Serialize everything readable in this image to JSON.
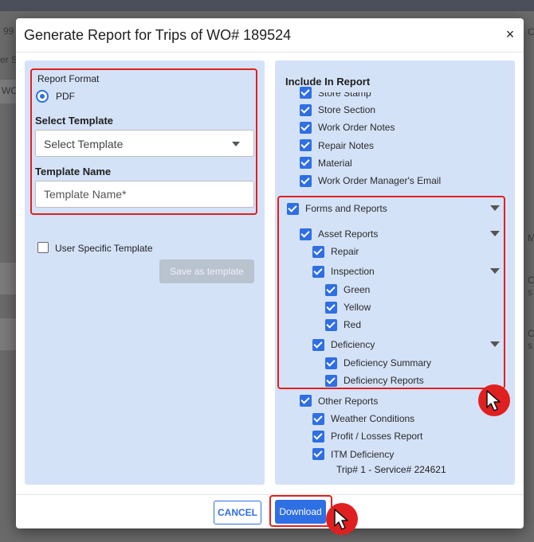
{
  "background": {
    "left_labels": [
      "99",
      "er S",
      "WC"
    ],
    "right_labels": [
      "C",
      "M",
      "C",
      "s",
      "C",
      "s"
    ]
  },
  "modal": {
    "title": "Generate Report for Trips of WO# 189524",
    "close_icon": "close-icon",
    "close_label": "×"
  },
  "left": {
    "report_format_label": "Report Format",
    "format_option": "PDF",
    "select_template_label": "Select Template",
    "select_template_value": "Select Template",
    "template_name_label": "Template Name",
    "template_name_placeholder": "Template Name*",
    "user_specific_label": "User Specific Template",
    "save_template_label": "Save as template"
  },
  "right": {
    "include_title": "Include In Report",
    "items": [
      {
        "label": "Store Stamp"
      },
      {
        "label": "Store Section"
      },
      {
        "label": "Work Order Notes"
      },
      {
        "label": "Repair Notes"
      },
      {
        "label": "Material"
      },
      {
        "label": "Work Order Manager's Email"
      },
      {
        "label": "Forms and Reports"
      },
      {
        "label": "Asset Reports"
      },
      {
        "label": "Repair"
      },
      {
        "label": "Inspection"
      },
      {
        "label": "Green"
      },
      {
        "label": "Yellow"
      },
      {
        "label": "Red"
      },
      {
        "label": "Deficiency"
      },
      {
        "label": "Deficiency Summary"
      },
      {
        "label": "Deficiency Reports"
      },
      {
        "label": "Other Reports"
      },
      {
        "label": "Weather Conditions"
      },
      {
        "label": "Profit / Losses Report"
      },
      {
        "label": "ITM Deficiency"
      }
    ],
    "trip_label": "Trip# 1 - Service# 224621"
  },
  "footer": {
    "cancel_label": "CANCEL",
    "download_label": "Download"
  },
  "colors": {
    "accent": "#2f6fe4",
    "highlight": "#e02020",
    "panel": "#d4e2f8"
  }
}
